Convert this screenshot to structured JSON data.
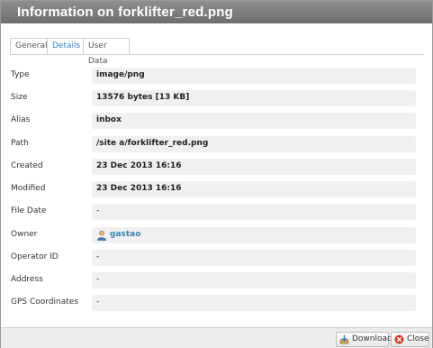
{
  "dialog": {
    "title": "Information on forklifter_red.png"
  },
  "tabs": [
    {
      "label": "General",
      "active": false
    },
    {
      "label": "Details",
      "active": true
    },
    {
      "label": "User Data",
      "active": false
    }
  ],
  "details": [
    {
      "label": "Type",
      "value": "image/png"
    },
    {
      "label": "Size",
      "value": "13576 bytes [13 KB]"
    },
    {
      "label": "Alias",
      "value": "inbox"
    },
    {
      "label": "Path",
      "value": "/site a/forklifter_red.png"
    },
    {
      "label": "Created",
      "value": "23 Dec 2013 16:16"
    },
    {
      "label": "Modified",
      "value": "23 Dec 2013 16:16"
    },
    {
      "label": "File Date",
      "value": "-"
    },
    {
      "label": "Owner",
      "value": "gastao"
    },
    {
      "label": "Operator ID",
      "value": "-"
    },
    {
      "label": "Address",
      "value": "-"
    },
    {
      "label": "GPS Coordinates",
      "value": "-"
    }
  ],
  "buttons": {
    "download_label": "Download",
    "close_label": "Close"
  },
  "colors": {
    "accent": "#3d84b6",
    "titlebar": "#7d7d7d"
  },
  "icons": {
    "owner": "user-icon",
    "download": "download-icon",
    "close": "close-icon"
  }
}
